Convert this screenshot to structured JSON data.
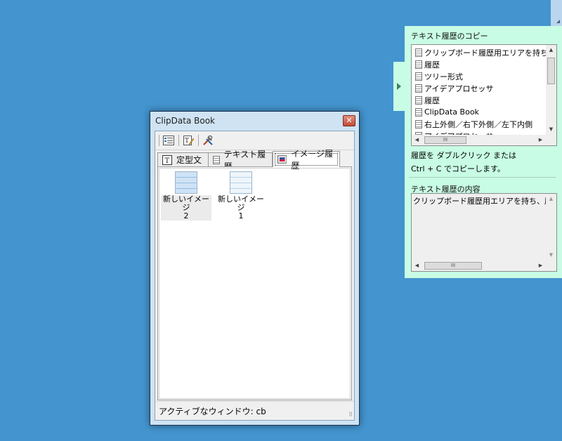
{
  "window": {
    "title": "ClipData Book",
    "close_glyph": "✕",
    "toolbar": {
      "icons": [
        "list-view-icon",
        "edit-note-icon",
        "tools-icon"
      ]
    },
    "tabs": [
      {
        "label": "定型文",
        "icon": "text-t-icon"
      },
      {
        "label": "テキスト履歴",
        "icon": "document-icon"
      },
      {
        "label": "イメージ履歴",
        "icon": "image-icon",
        "active": true
      }
    ],
    "images": [
      {
        "label": "新しいイメージ\n2",
        "selected": true
      },
      {
        "label": "新しいイメージ\n1",
        "selected": false
      }
    ],
    "status": "アクティブなウィンドウ: cb"
  },
  "panel": {
    "list_title": "テキスト履歴のコピー",
    "items": [
      "クリップボード履歴用エリアを持ち、履",
      "履歴",
      "ツリー形式",
      "アイデアプロセッサ",
      "履歴",
      "ClipData Book",
      "右上外側／右下外側／左下内側",
      "アイデアプロセッサ"
    ],
    "hint_line1": "履歴を ダブルクリック または",
    "hint_line2": "Ctrl + C でコピーします。",
    "content_title": "テキスト履歴の内容",
    "content_text": "クリップボード履歴用エリアを持ち、履歴-",
    "scroll_thumb_glyph": "III"
  },
  "colors": {
    "desktop": "#4394cf",
    "panel": "#c8fce4"
  }
}
